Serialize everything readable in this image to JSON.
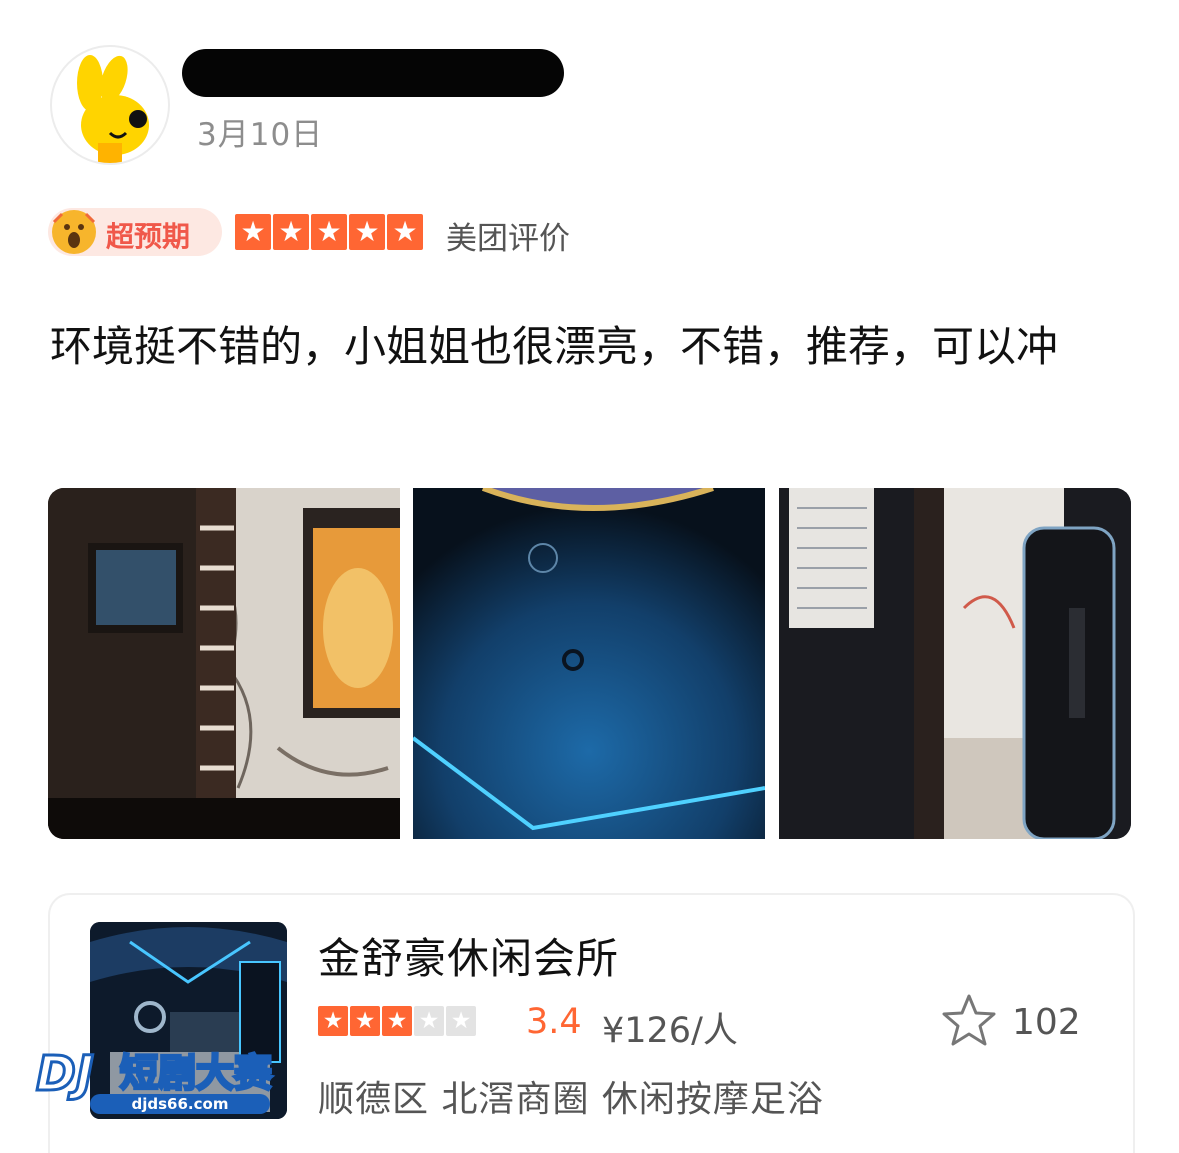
{
  "header": {
    "avatar_icon": "yellow-rabbit-mascot-icon",
    "date": "3月10日"
  },
  "rating": {
    "badge_label": "超预期",
    "badge_icon": "surprised-face-icon",
    "stars": 5,
    "max_stars": 5,
    "source_label": "美团评价"
  },
  "review": {
    "text": "环境挺不错的，小姐姐也很漂亮，不错，推荐，可以冲"
  },
  "photos": [
    {
      "subject": "karaoke-room-photo"
    },
    {
      "subject": "blue-ceiling-light-photo"
    },
    {
      "subject": "room-doorway-photo"
    }
  ],
  "shop": {
    "name": "金舒豪休闲会所",
    "stars": 3,
    "max_stars": 5,
    "score": "3.4",
    "price": "¥126/人",
    "favorite_count": "102",
    "location": "顺德区 北滘商圈 休闲按摩足浴"
  },
  "watermark": {
    "logo_text": "短剧大赛",
    "logo_site": "djds66.com",
    "logo_mark": "DJ"
  },
  "colors": {
    "accent": "#ff6633",
    "badge_bg": "#fde8e2",
    "badge_text": "#f0584a"
  }
}
